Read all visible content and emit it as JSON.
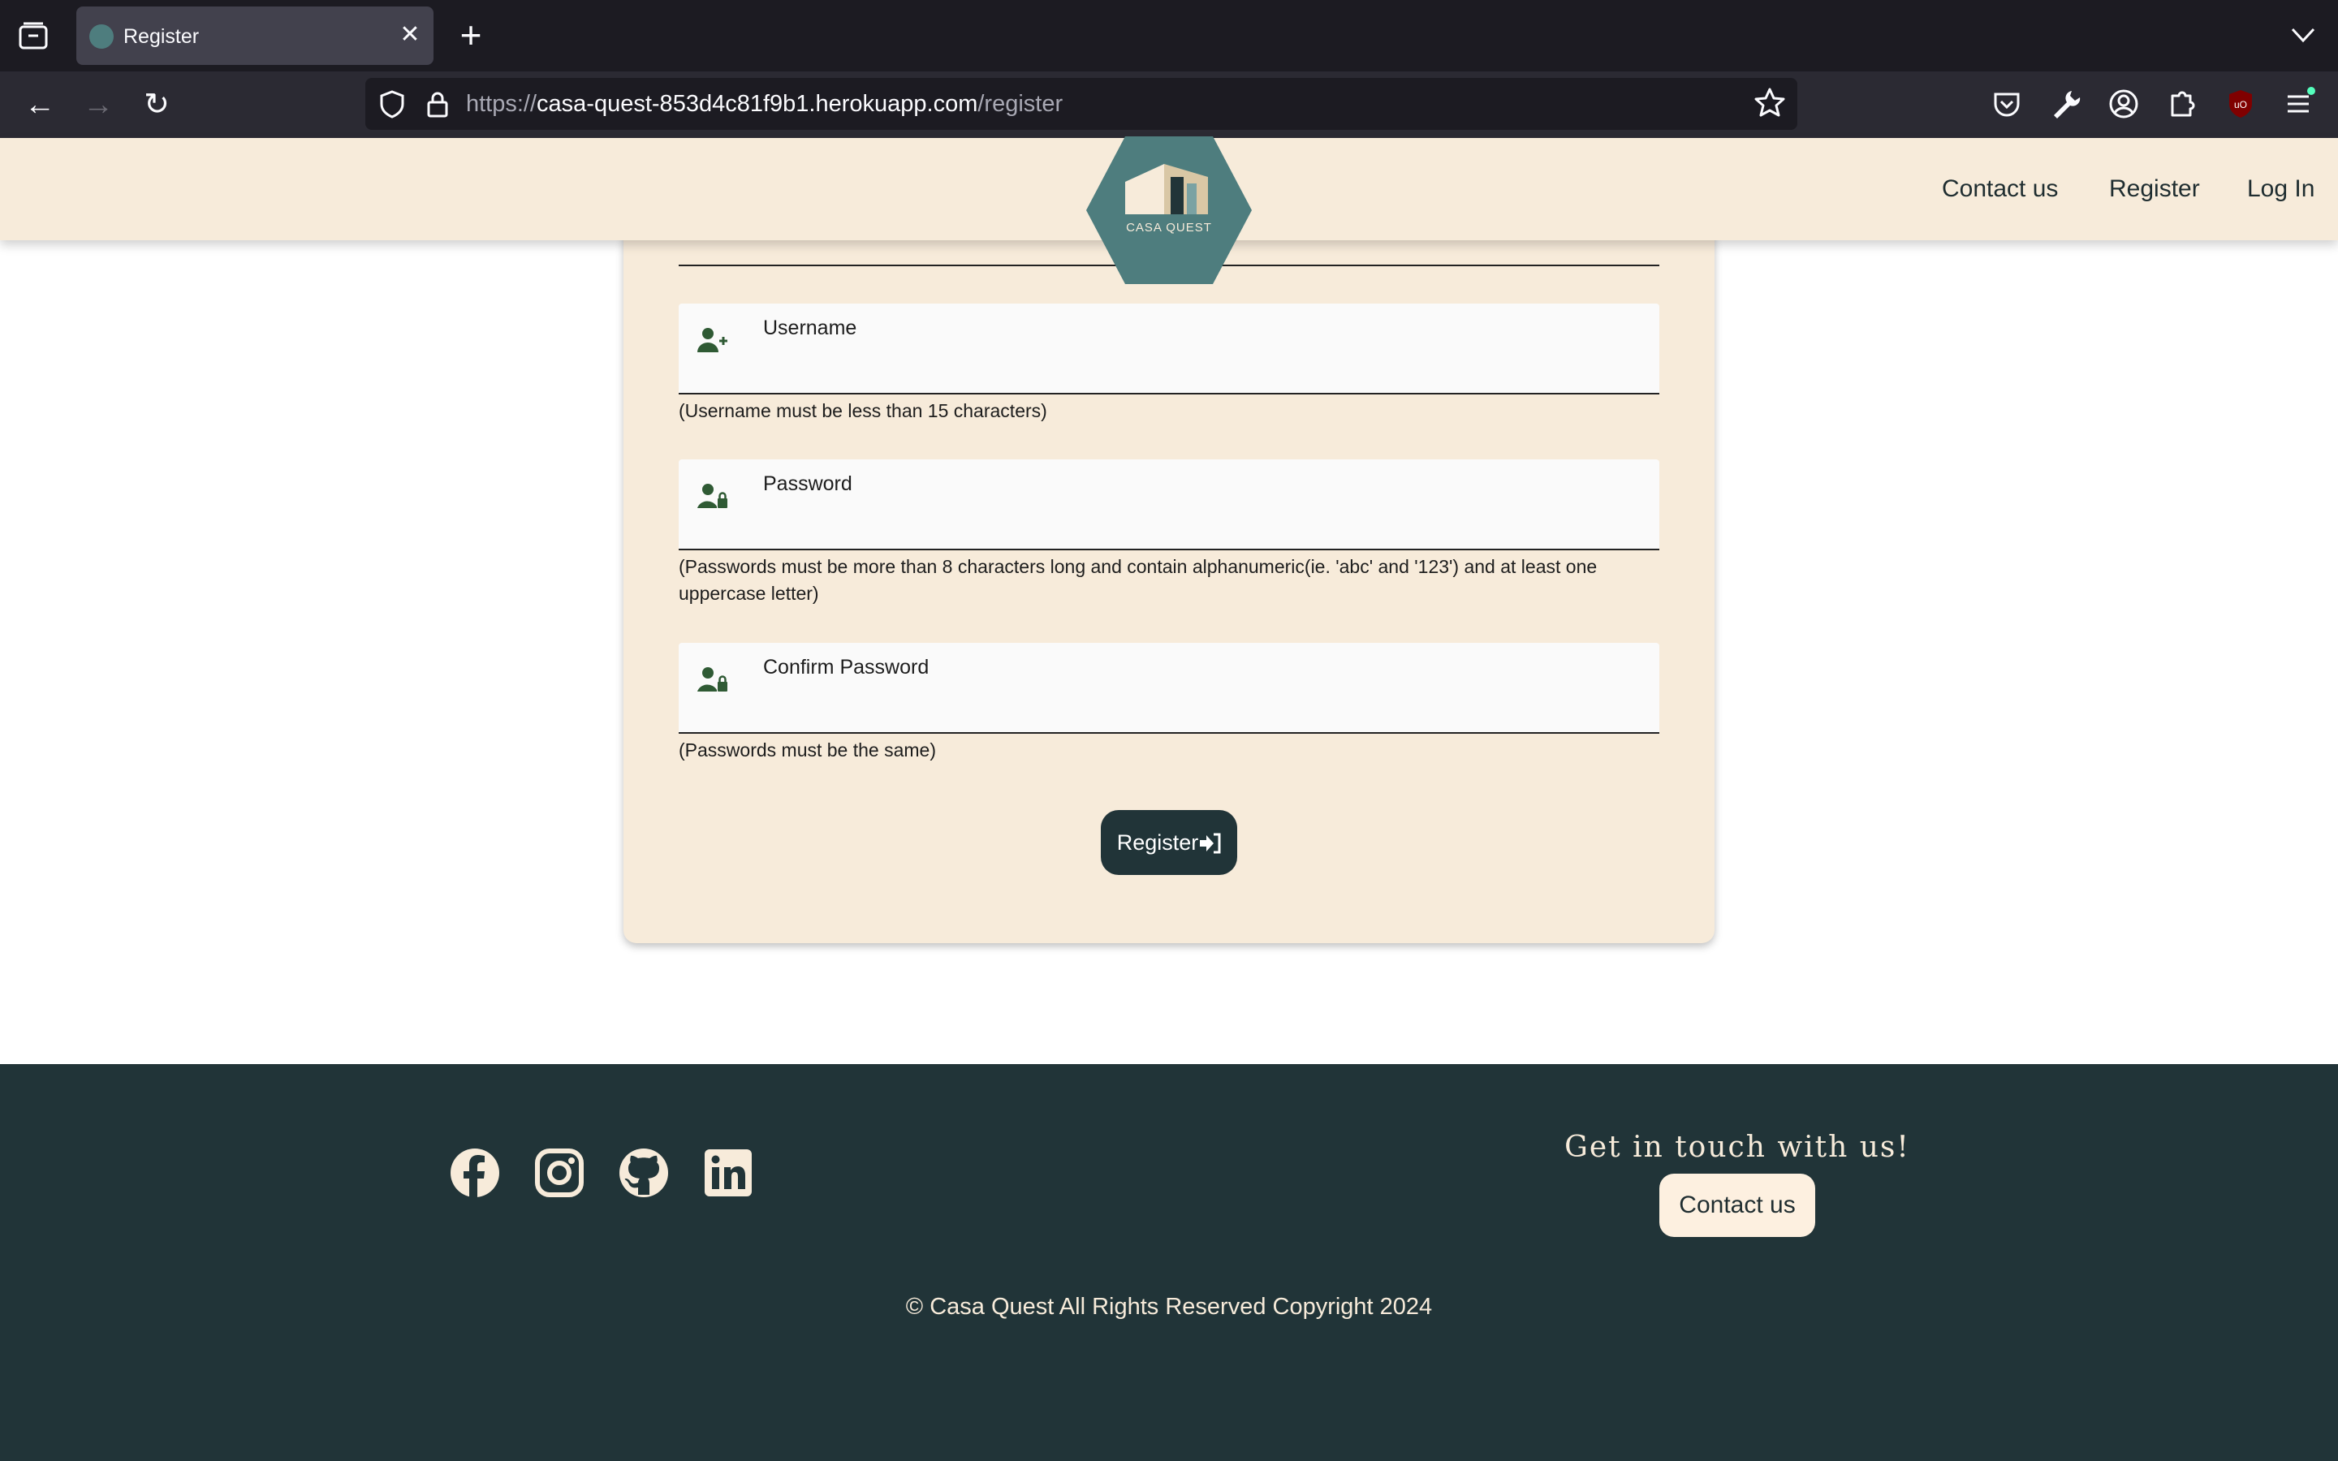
{
  "browser": {
    "tab_title": "Register",
    "close_glyph": "✕",
    "new_tab_glyph": "+",
    "url_scheme": "https://",
    "url_host": "casa-quest-853d4c81f9b1.herokuapp.com",
    "url_path": "/register",
    "back_glyph": "←",
    "forward_glyph": "→",
    "reload_glyph": "↻"
  },
  "header": {
    "logo_text": "CASA QUEST",
    "nav": [
      "Contact us",
      "Register",
      "Log In"
    ]
  },
  "form": {
    "username_label": "Username",
    "username_hint": "(Username must be less than 15 characters)",
    "password_label": "Password",
    "password_hint": "(Passwords must be more than 8 characters long and contain alphanumeric(ie. 'abc' and '123') and at least one uppercase letter)",
    "confirm_label": "Confirm Password",
    "confirm_hint": "(Passwords must be the same)",
    "submit_label": "Register"
  },
  "footer": {
    "social": [
      "facebook-icon",
      "instagram-icon",
      "github-icon",
      "linkedin-icon"
    ],
    "heading": "Get in touch with us!",
    "contact_label": "Contact us",
    "copyright": "© Casa Quest All Rights Reserved Copyright 2024"
  },
  "colors": {
    "cream": "#f7ebda",
    "dark_teal": "#213438",
    "logo_teal": "#4e7d7e",
    "icon_green": "#2f5a34"
  }
}
